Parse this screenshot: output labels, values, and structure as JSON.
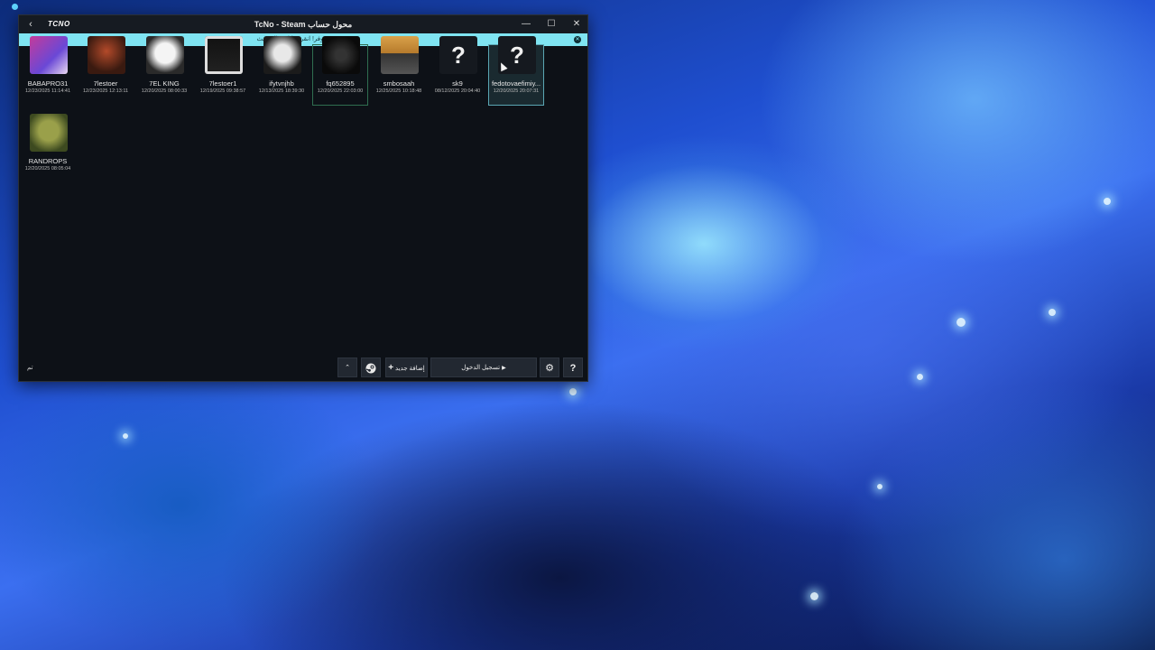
{
  "window": {
    "logo": "TCNO",
    "title": "TcNo - Steam محول حساب",
    "back_glyph": "‹",
    "minimize_glyph": "—",
    "maximize_glyph": "☐",
    "close_glyph": "✕"
  },
  "banner": {
    "text": "تحديث متوفر! انقر هنا لبدء التحديث.",
    "close_glyph": "✕"
  },
  "accounts": [
    {
      "name": "BABAPRO31",
      "date": "12/23/2025 11:14:41",
      "avatar": "skull-avatar"
    },
    {
      "name": "7lestoer",
      "date": "12/23/2025 12:13:11",
      "avatar": "demon-avatar"
    },
    {
      "name": "7EL KING",
      "date": "12/20/2025 08:00:33",
      "avatar": "white-figure-avatar"
    },
    {
      "name": "7lestoer1",
      "date": "12/19/2025 09:38:57",
      "avatar": "sketch-avatar"
    },
    {
      "name": "ifytvnjhb",
      "date": "12/13/2025 18:39:30",
      "avatar": "portrait-avatar"
    },
    {
      "name": "fq652895",
      "date": "12/20/2025 22:03:00",
      "avatar": "dark-avatar"
    },
    {
      "name": "smbosaah",
      "date": "12/25/2025 10:18:48",
      "avatar": "person-avatar"
    },
    {
      "name": "sk9",
      "date": "08/12/2025 20:04:40",
      "avatar": "question-avatar"
    },
    {
      "name": "fedotovaefimiy...",
      "date": "12/20/2025 20:07:31",
      "avatar": "question-avatar"
    },
    {
      "name": "RANDROPS",
      "date": "12/20/2025 08:05:04",
      "avatar": "orc-avatar"
    }
  ],
  "footer": {
    "status": "تم",
    "up_glyph": "⌃",
    "steam_icon": "steam-icon",
    "add_new_label": "إضافة جديد",
    "login_label": "تسجيل الدخول",
    "settings_icon": "gear-icon",
    "help_label": "?"
  },
  "colors": {
    "accent": "#7fe4f2",
    "window_bg": "#0d1117",
    "selected_border": "#2f6e50",
    "hover_border": "#5aa6b3"
  }
}
